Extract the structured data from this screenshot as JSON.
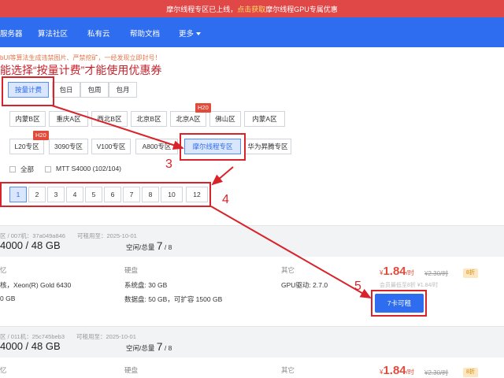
{
  "banner": {
    "prefix": "摩尔线程专区已上线，",
    "link": "点击获取",
    "suffix": "摩尔线程GPU专属优惠"
  },
  "nav": {
    "items": [
      {
        "label": "服务器"
      },
      {
        "label": "算法社区"
      },
      {
        "label": "私有云"
      },
      {
        "label": "帮助文档"
      },
      {
        "label": "更多"
      }
    ]
  },
  "notice": "bUI等算法生成违禁图片、严禁挖矿，一经发现立即封号！",
  "tip": "能选择“按量计费”才能使用优惠券",
  "billing": {
    "options": [
      "按量计费",
      "包日",
      "包周",
      "包月"
    ],
    "selected": "按量计费"
  },
  "regions": [
    "内蒙B区",
    "重庆A区",
    "西北B区",
    "北京B区",
    "北京A区",
    "佛山区",
    "内蒙A区"
  ],
  "regions_badge": "H20",
  "zones": [
    "L20专区",
    "3090专区",
    "V100专区",
    "A800专区",
    "摩尔线程专区",
    "华为昇腾专区"
  ],
  "zones_badge": "H20",
  "zones_selected": "摩尔线程专区",
  "filters": {
    "all": "全部",
    "gpu": "MTT S4000 (102/104)"
  },
  "pages": [
    "1",
    "2",
    "3",
    "4",
    "5",
    "6",
    "7",
    "8",
    "10",
    "12"
  ],
  "current_page": "1",
  "annotations": [
    "3",
    "4",
    "5"
  ],
  "cards": [
    {
      "meta": "区 / 007机：37a049a846　　可租用至：2025-10-01",
      "gpu": "4000 / 48 GB",
      "avail_prefix": "空闲/总量",
      "avail_free": "7",
      "avail_total": "/ 8",
      "col1_label": "忆",
      "col1_v1": "核，Xeon(R) Gold 6430",
      "col1_v2": "0 GB",
      "disk_label": "硬盘",
      "disk_sys": "系统盘:  30 GB",
      "disk_data": "数据盘:  50 GB，可扩容 1500 GB",
      "other_label": "其它",
      "other_v1": "GPU驱动:  2.7.0",
      "price_sym": "¥",
      "price_num": "1.84",
      "price_unit": "/时",
      "old_price": "¥2.30/时",
      "discount": "8折",
      "member": "会员最低至8折 ¥1.84/时",
      "rent": "7卡可租"
    },
    {
      "meta": "区 / 011机：25c745beb3　　可租用至：2025-10-01",
      "gpu": "4000 / 48 GB",
      "avail_prefix": "空闲/总量",
      "avail_free": "7",
      "avail_total": "/ 8",
      "col1_label": "忆",
      "disk_label": "硬盘",
      "other_label": "其它",
      "price_sym": "¥",
      "price_num": "1.84",
      "price_unit": "/时",
      "old_price": "¥2.30/时",
      "discount": "8折"
    }
  ],
  "colors": {
    "nav": "#2e6cf0",
    "banner": "#e04848",
    "annotation": "#d8232a",
    "price": "#e24b3b"
  }
}
